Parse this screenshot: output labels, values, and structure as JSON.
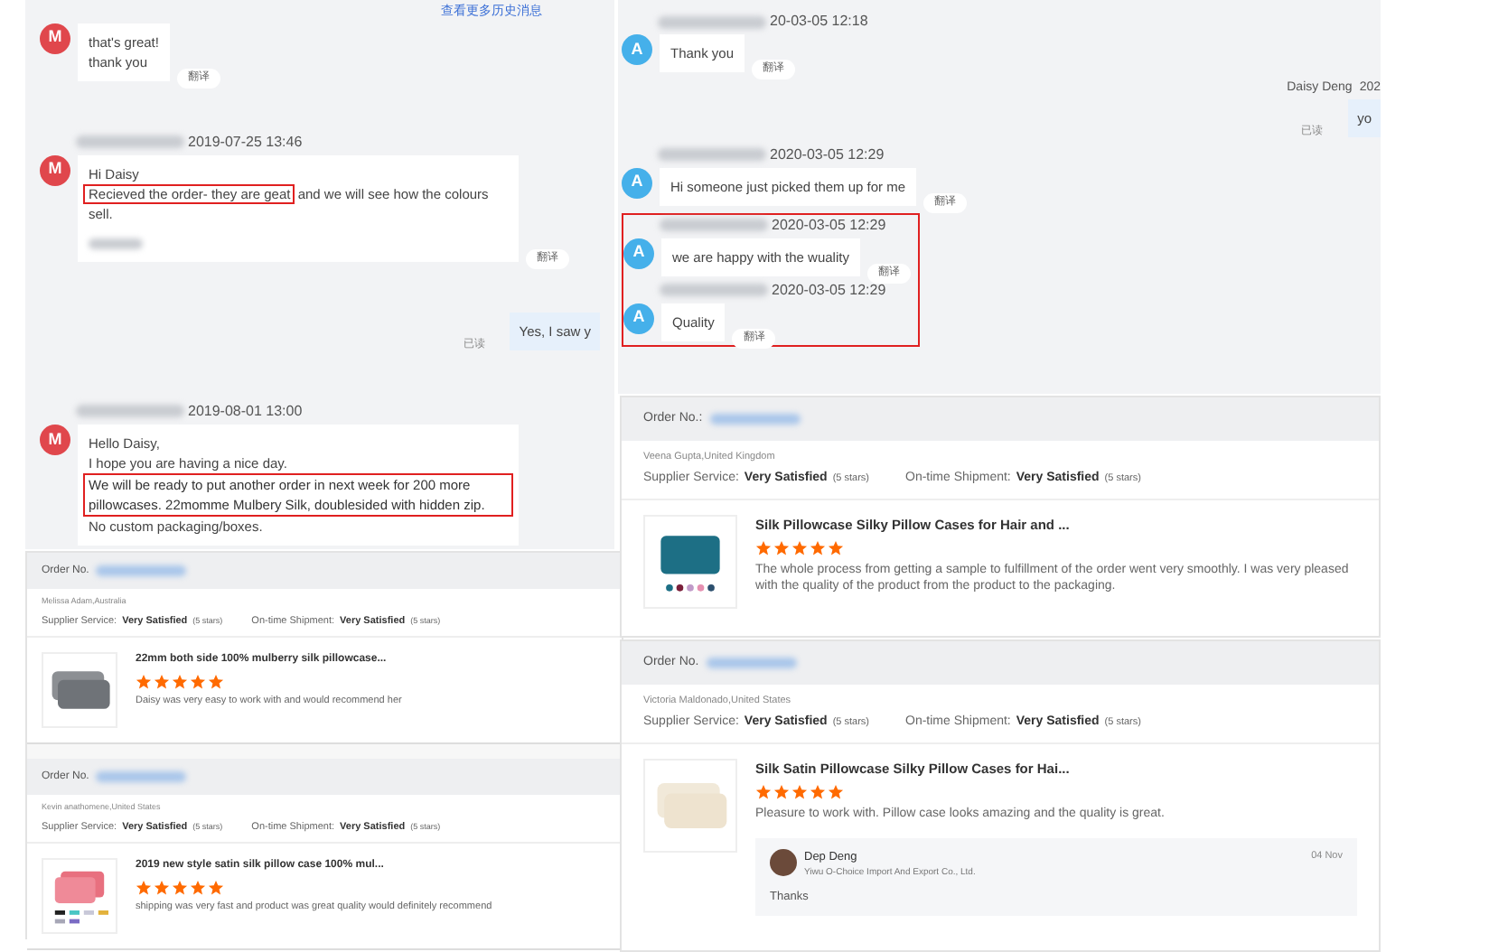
{
  "chat_panels": [
    {
      "history_link": "查看更多历史消息",
      "items": [
        {
          "kind": "incoming",
          "avatar": "M",
          "color": "#e0474c",
          "paragraphs": [
            [
              {
                "text": "that's great!",
                "highlighted": false
              }
            ],
            [
              {
                "text": "thank you",
                "highlighted": false
              }
            ]
          ],
          "translate": "翻译"
        },
        {
          "kind": "incoming",
          "avatar": "M",
          "color": "#e0474c",
          "timestamp": "2019-07-25 13:46",
          "paragraphs": [
            [
              {
                "text": "Hi Daisy",
                "highlighted": false
              }
            ],
            [
              {
                "text": "Recieved the order- they are geat",
                "highlighted": true
              },
              {
                "text": " and we will see how the colours sell.",
                "highlighted": false
              }
            ]
          ],
          "blurred_signature": true,
          "translate": "翻译"
        },
        {
          "kind": "outgoing",
          "paragraphs": [
            [
              {
                "text": "Yes, I saw y",
                "highlighted": false
              }
            ]
          ],
          "read": "已读"
        },
        {
          "kind": "incoming",
          "avatar": "M",
          "color": "#e0474c",
          "timestamp": "2019-08-01 13:00",
          "paragraphs": [
            [
              {
                "text": "Hello Daisy,",
                "highlighted": false
              }
            ],
            [
              {
                "text": "I hope you are having a nice day.",
                "highlighted": false
              }
            ],
            [
              {
                "text": "We will be ready to put another order in next week for 200 more pillowcases. 22momme Mulbery Silk, doublesided with hidden zip.",
                "highlighted": true
              }
            ],
            [
              {
                "text": "No custom packaging/boxes.",
                "highlighted": false
              }
            ]
          ]
        }
      ]
    },
    {
      "items": [
        {
          "kind": "incoming",
          "avatar": "A",
          "color": "#45b0ea",
          "timestamp": "20-03-05 12:18",
          "paragraphs": [
            [
              {
                "text": "Thank you",
                "highlighted": false
              }
            ]
          ],
          "translate": "翻译"
        },
        {
          "kind": "outgoing",
          "sender": "Daisy Deng",
          "timestamp": "202",
          "paragraphs": [
            [
              {
                "text": "yo",
                "highlighted": false
              }
            ]
          ],
          "read": "已读"
        },
        {
          "kind": "incoming",
          "avatar": "A",
          "color": "#45b0ea",
          "timestamp": "2020-03-05 12:29",
          "paragraphs": [
            [
              {
                "text": "Hi someone just picked them up for me",
                "highlighted": false
              }
            ]
          ],
          "translate": "翻译"
        },
        {
          "kind": "highlight",
          "items": [
            {
              "kind": "incoming",
              "avatar": "A",
              "color": "#45b0ea",
              "timestamp": "2020-03-05 12:29",
              "paragraphs": [
                [
                  {
                    "text": "we are happy with the wuality",
                    "highlighted": false
                  }
                ]
              ],
              "translate": "翻译"
            },
            {
              "kind": "incoming",
              "avatar": "A",
              "color": "#45b0ea",
              "timestamp": "2020-03-05 12:29",
              "paragraphs": [
                [
                  {
                    "text": "Quality",
                    "highlighted": false
                  }
                ]
              ],
              "translate": "翻译"
            }
          ]
        }
      ]
    }
  ],
  "review_panels": [
    {
      "reviews": [
        {
          "order_label": "Order No.",
          "buyer": "Melissa Adam,Australia",
          "supplier_label": "Supplier Service:",
          "supplier_rating": "Very Satisfied",
          "supplier_stars_label": "(5 stars)",
          "shipment_label": "On-time Shipment:",
          "shipment_rating": "Very Satisfied",
          "shipment_stars_label": "(5 stars)",
          "product_title": "22mm both side 100% mulberry silk pillowcase...",
          "stars": 5,
          "comment": "Daisy was very easy to work with and would recommend her"
        },
        {
          "order_label": "Order No.",
          "buyer": "Kevin anathomene,United States",
          "supplier_label": "Supplier Service:",
          "supplier_rating": "Very Satisfied",
          "supplier_stars_label": "(5 stars)",
          "shipment_label": "On-time Shipment:",
          "shipment_rating": "Very Satisfied",
          "shipment_stars_label": "(5 stars)",
          "product_title": "2019 new style satin silk pillow case 100% mul...",
          "stars": 5,
          "comment": "shipping was very fast and product was great quality would definitely recommend"
        }
      ]
    },
    {
      "reviews": [
        {
          "order_label": "Order No.:",
          "buyer": "Veena Gupta,United Kingdom",
          "supplier_label": "Supplier Service:",
          "supplier_rating": "Very Satisfied",
          "supplier_stars_label": "(5 stars)",
          "shipment_label": "On-time Shipment:",
          "shipment_rating": "Very Satisfied",
          "shipment_stars_label": "(5 stars)",
          "product_title": "Silk Pillowcase Silky Pillow Cases for Hair and ...",
          "stars": 5,
          "comment": "The whole process from getting a sample to fulfillment of the order went very smoothly. I was very pleased with the quality of the product from the product to the packaging."
        }
      ]
    },
    {
      "reviews": [
        {
          "order_label": "Order No.",
          "buyer": "Victoria Maldonado,United States",
          "supplier_label": "Supplier Service:",
          "supplier_rating": "Very Satisfied",
          "supplier_stars_label": "(5 stars)",
          "shipment_label": "On-time Shipment:",
          "shipment_rating": "Very Satisfied",
          "shipment_stars_label": "(5 stars)",
          "product_title": "Silk Satin Pillowcase Silky Pillow Cases for Hai...",
          "stars": 5,
          "comment": "Pleasure to work with. Pillow case looks amazing and the quality is great.",
          "reply": {
            "name": "Dep Deng",
            "company": "Yiwu O-Choice Import And Export Co., Ltd.",
            "date": "04 Nov",
            "text": "Thanks"
          }
        }
      ]
    }
  ]
}
